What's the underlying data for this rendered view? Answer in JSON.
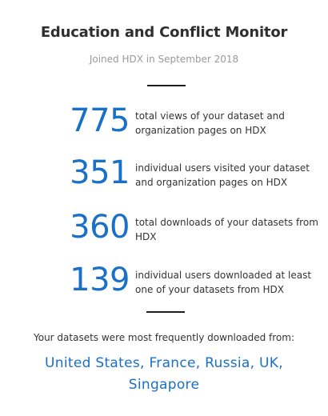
{
  "header": {
    "title": "Education and Conflict Monitor",
    "subtitle": "Joined HDX in September 2018"
  },
  "stats": [
    {
      "value": "775",
      "description": "total views of your dataset and organization pages on HDX"
    },
    {
      "value": "351",
      "description": "individual users visited your dataset and organization pages on HDX"
    },
    {
      "value": "360",
      "description": "total downloads of your datasets from HDX"
    },
    {
      "value": "139",
      "description": "individual users downloaded at least one of your datasets from HDX"
    }
  ],
  "downloads": {
    "label": "Your datasets were most frequently downloaded from:",
    "countries": "United States, France, Russia, UK, Singapore"
  },
  "colors": {
    "accent": "#1a70c7",
    "text": "#333333",
    "muted": "#9a9a9a"
  }
}
